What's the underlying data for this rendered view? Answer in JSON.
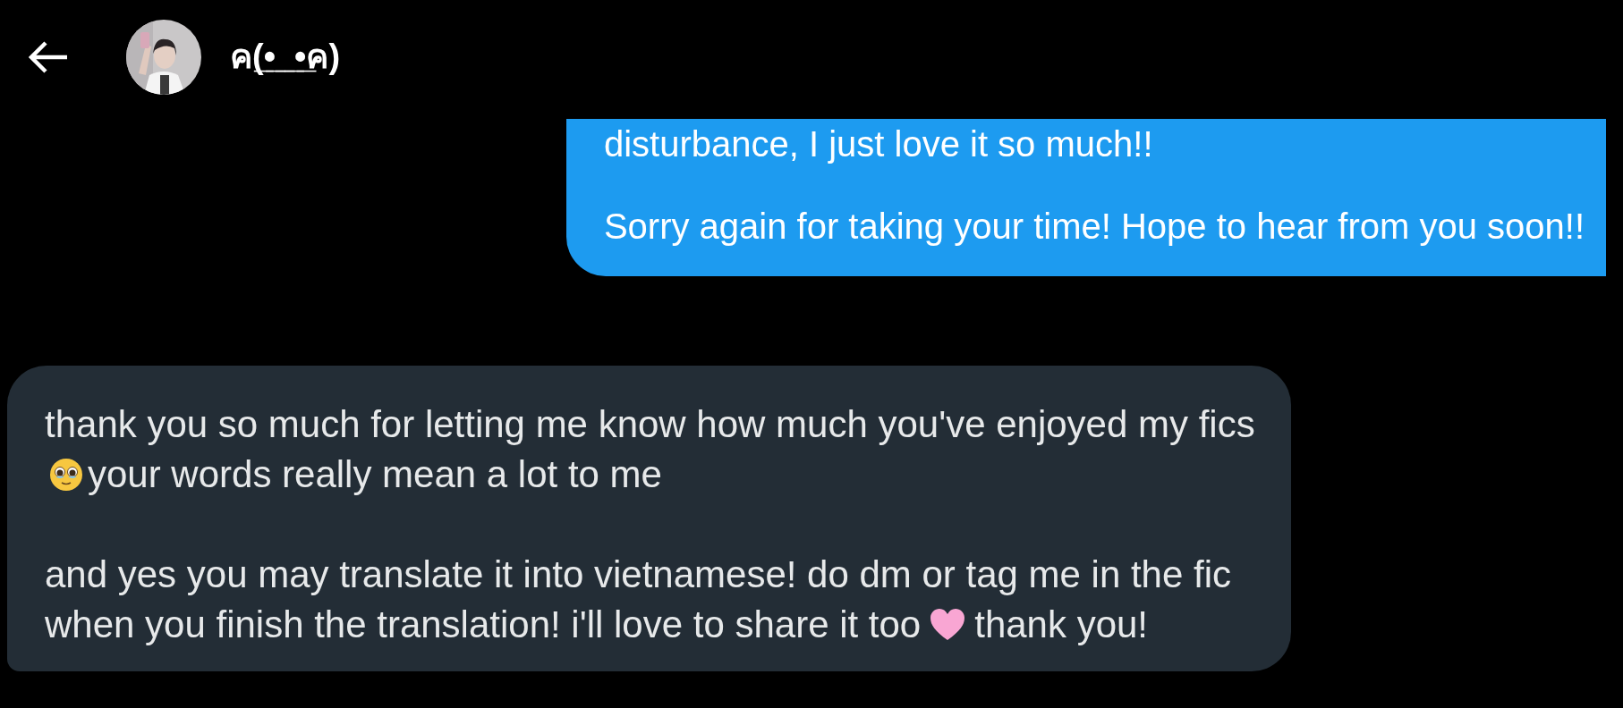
{
  "header": {
    "contact_name": "ค(̲•̲_̲•̲ค)"
  },
  "messages": [
    {
      "kind": "sent",
      "paragraphs": [
        [
          [
            {
              "kind": "text",
              "text": "disturbance, I just love it so much!!"
            }
          ]
        ],
        [
          [
            {
              "kind": "text",
              "text": "Sorry again for taking your time! Hope to hear from you soon!!"
            }
          ]
        ]
      ]
    },
    {
      "kind": "received",
      "paragraphs": [
        [
          [
            {
              "kind": "text",
              "text": "thank you so much for letting me know how much you've enjoyed my fics"
            }
          ],
          [
            {
              "kind": "pleading-face"
            },
            {
              "kind": "text",
              "text": "your words really mean a lot to me"
            }
          ]
        ],
        [
          [
            {
              "kind": "text",
              "text": "and yes you may translate it into vietnamese! do dm or tag me in the fic"
            }
          ],
          [
            {
              "kind": "text",
              "text": "when you finish the translation! i'll love to share it too"
            },
            {
              "kind": "pink-heart"
            },
            {
              "kind": "text",
              "text": "thank you!"
            }
          ]
        ]
      ]
    }
  ]
}
